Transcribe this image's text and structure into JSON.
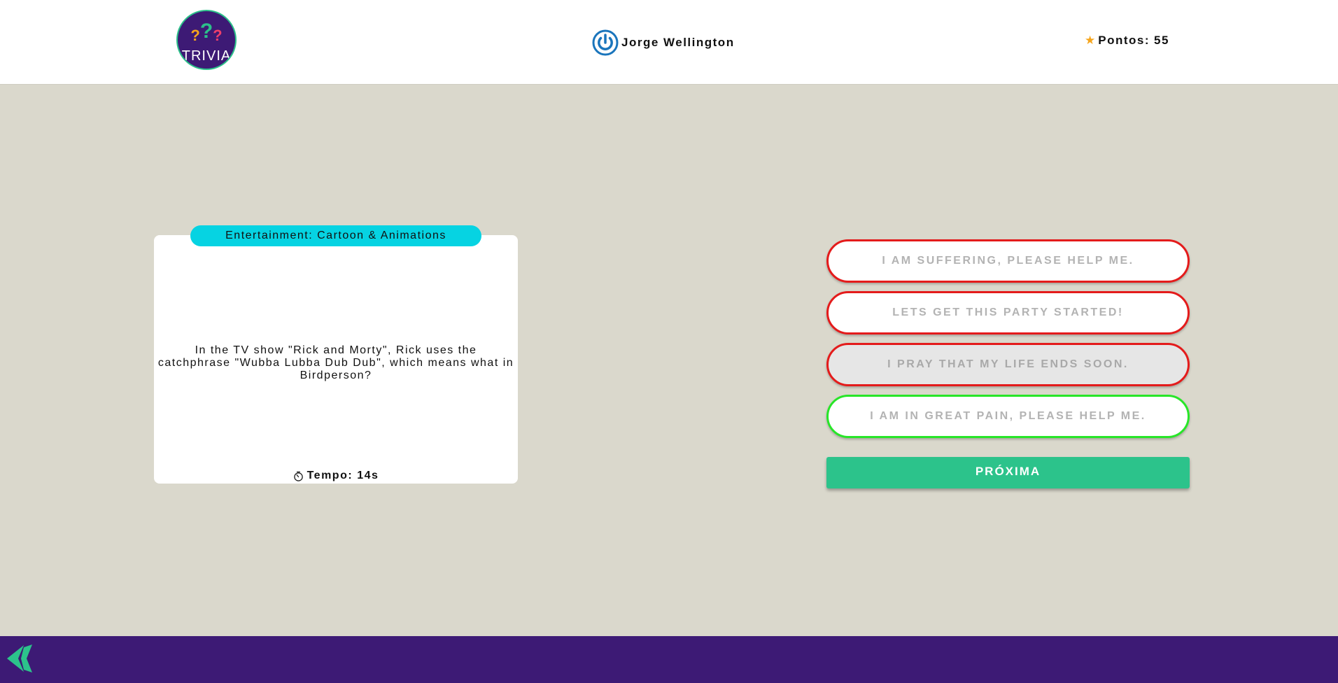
{
  "header": {
    "logo": {
      "text": "TRIVIA",
      "q1": "?",
      "q2": "?",
      "q3": "?"
    },
    "player_name": "Jorge Wellington",
    "score_label": "Pontos:",
    "score_value": "55"
  },
  "question_card": {
    "category": "Entertainment: Cartoon & Animations",
    "question": "In the TV show \"Rick and Morty\", Rick uses the catchphrase \"Wubba Lubba Dub Dub\", which means what in Birdperson?",
    "timer_label": "Tempo:",
    "timer_value": "14s"
  },
  "answers": [
    {
      "label": "I AM SUFFERING, PLEASE HELP ME.",
      "state": "wrong"
    },
    {
      "label": "LETS GET THIS PARTY STARTED!",
      "state": "wrong"
    },
    {
      "label": "I PRAY THAT MY LIFE ENDS SOON.",
      "state": "wrong-selected"
    },
    {
      "label": "I AM IN GREAT PAIN, PLEASE HELP ME.",
      "state": "correct"
    }
  ],
  "next_button": {
    "label": "PRÓXIMA"
  },
  "colors": {
    "background": "#dad8cc",
    "brand_purple": "#3d1a75",
    "category_cyan": "#06d3e2",
    "accent_green": "#2cc38b",
    "wrong_red": "#e41b1b",
    "correct_green": "#28e628",
    "star_orange": "#f6a51c",
    "power_blue": "#1a75bc"
  },
  "icons": {
    "player": "power-icon",
    "score": "star-icon",
    "timer": "timer-icon",
    "footer": "footer-logo-icon"
  }
}
